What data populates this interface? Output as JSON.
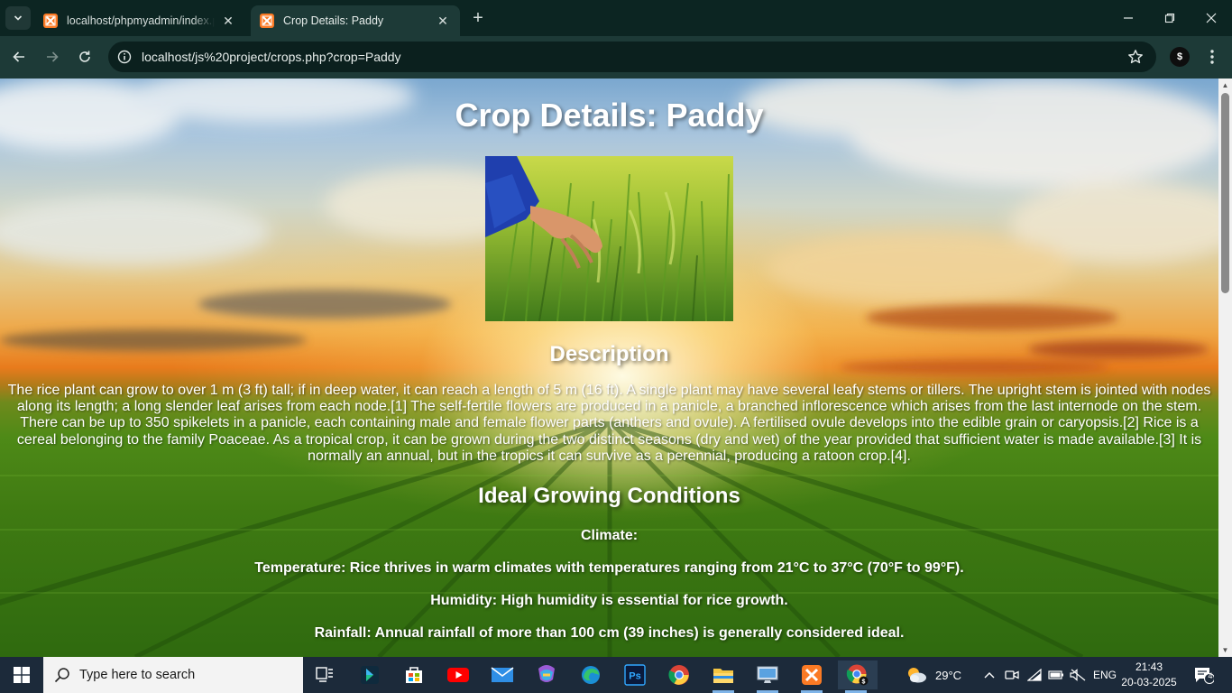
{
  "browser": {
    "tabs": [
      {
        "title": "localhost/phpmyadmin/index.php",
        "active": false
      },
      {
        "title": "Crop Details: Paddy",
        "active": true
      }
    ],
    "url": "localhost/js%20project/crops.php?crop=Paddy",
    "profile_letter": "$"
  },
  "page": {
    "title": "Crop Details: Paddy",
    "description_heading": "Description",
    "description": "The rice plant can grow to over 1 m (3 ft) tall; if in deep water, it can reach a length of 5 m (16 ft). A single plant may have several leafy stems or tillers. The upright stem is jointed with nodes along its length; a long slender leaf arises from each node.[1] The self-fertile flowers are produced in a panicle, a branched inflorescence which arises from the last internode on the stem. There can be up to 350 spikelets in a panicle, each containing male and female flower parts (anthers and ovule). A fertilised ovule develops into the edible grain or caryopsis.[2] Rice is a cereal belonging to the family Poaceae. As a tropical crop, it can be grown during the two distinct seasons (dry and wet) of the year provided that sufficient water is made available.[3] It is normally an annual, but in the tropics it can survive as a perennial, producing a ratoon crop.[4].",
    "conditions_heading": "Ideal Growing Conditions",
    "climate_label": "Climate:",
    "temperature": "Temperature: Rice thrives in warm climates with temperatures ranging from 21°C to 37°C (70°F to 99°F).",
    "humidity": "Humidity: High humidity is essential for rice growth.",
    "rainfall": "Rainfall: Annual rainfall of more than 100 cm (39 inches) is generally considered ideal."
  },
  "taskbar": {
    "search_placeholder": "Type here to search",
    "weather_temp": "29°C",
    "language": "ENG",
    "time": "21:43",
    "date": "20-03-2025",
    "notification_count": "4"
  },
  "icons": [
    "windows-start-icon",
    "search-icon",
    "task-view-icon",
    "store-icon",
    "youtube-icon",
    "mail-icon",
    "m365-icon",
    "edge-icon",
    "photoshop-icon",
    "chrome-icon",
    "file-explorer-icon",
    "remote-desktop-icon",
    "xampp-icon",
    "weather-icon",
    "chevron-up-icon",
    "wifi-icon",
    "battery-icon",
    "notification-icon"
  ]
}
